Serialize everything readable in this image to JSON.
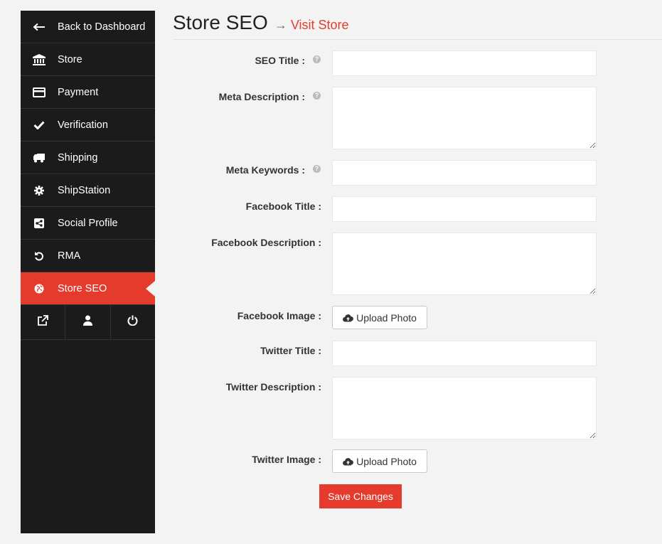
{
  "sidebar": {
    "items": [
      {
        "label": "Back to Dashboard",
        "icon": "arrow-left-icon"
      },
      {
        "label": "Store",
        "icon": "bank-icon"
      },
      {
        "label": "Payment",
        "icon": "credit-card-icon"
      },
      {
        "label": "Verification",
        "icon": "check-icon"
      },
      {
        "label": "Shipping",
        "icon": "truck-icon"
      },
      {
        "label": "ShipStation",
        "icon": "gear-icon"
      },
      {
        "label": "Social Profile",
        "icon": "share-icon"
      },
      {
        "label": "RMA",
        "icon": "undo-icon"
      },
      {
        "label": "Store SEO",
        "icon": "globe-icon",
        "active": true
      }
    ],
    "bottom_icons": [
      "external-link-icon",
      "user-icon",
      "power-icon"
    ]
  },
  "header": {
    "title": "Store SEO",
    "arrow": "→",
    "visit_link": "Visit Store"
  },
  "form": {
    "seo_title_label": "SEO Title :",
    "meta_description_label": "Meta Description :",
    "meta_keywords_label": "Meta Keywords :",
    "facebook_title_label": "Facebook Title :",
    "facebook_description_label": "Facebook Description :",
    "facebook_image_label": "Facebook Image :",
    "twitter_title_label": "Twitter Title :",
    "twitter_description_label": "Twitter Description :",
    "twitter_image_label": "Twitter Image :",
    "upload_label": "Upload Photo",
    "help_glyph": "?",
    "values": {
      "seo_title": "",
      "meta_description": "",
      "meta_keywords": "",
      "facebook_title": "",
      "facebook_description": "",
      "twitter_title": "",
      "twitter_description": ""
    },
    "save_label": "Save Changes"
  },
  "colors": {
    "accent": "#e53b2c",
    "sidebar_bg": "#1b1b1b",
    "page_bg": "#f3f3f3"
  }
}
